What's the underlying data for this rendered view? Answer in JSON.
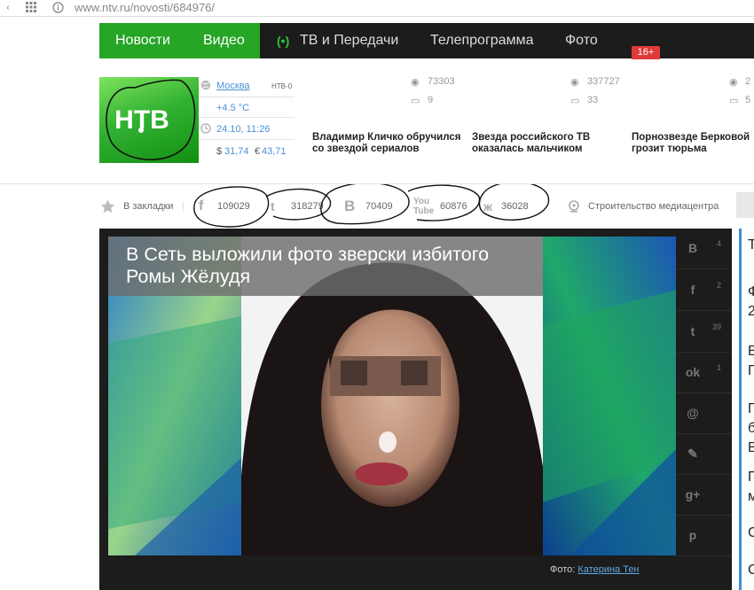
{
  "browser": {
    "url": "www.ntv.ru/novosti/684976/"
  },
  "nav": {
    "items": [
      "Новости",
      "Видео",
      "ТВ и Передачи",
      "Телепрограмма",
      "Фото"
    ],
    "live_marker": "(•)",
    "age_badge": "16+"
  },
  "logo": {
    "text": "НТВ"
  },
  "info": {
    "city": "Москва",
    "channel": "НТВ-0",
    "temp": "+4.5 °C",
    "datetime": "24.10, 11:26",
    "usd": "31,74",
    "eur": "43,71",
    "usd_symbol": "$",
    "eur_symbol": "€"
  },
  "top_news": [
    {
      "views": "73303",
      "comments": "9",
      "title": "Владимир Кличко обручился со звездой сериалов"
    },
    {
      "views": "337727",
      "comments": "33",
      "title": "Звезда российского ТВ оказалась мальчиком"
    },
    {
      "views": "",
      "comments": "",
      "title": "Порнозвезде Берковой грозит тюрьма"
    }
  ],
  "edge_stats": {
    "views": "2",
    "comments": "5"
  },
  "share": {
    "bookmark": "В закладки",
    "facebook": "109029",
    "twitter": "318279",
    "vk": "70409",
    "youtube": "60876",
    "ok": "36028",
    "media": "Строительство медиацентра"
  },
  "article": {
    "headline": "В Сеть выложили фото зверски избитого Ромы Жёлудя",
    "photo_credit_label": "Фото:",
    "photo_credit_name": "Катерина Тен"
  },
  "side_share": [
    {
      "icon": "B",
      "count": "4"
    },
    {
      "icon": "f",
      "count": "2"
    },
    {
      "icon": "t",
      "count": "39"
    },
    {
      "icon": "ok",
      "count": "1"
    },
    {
      "icon": "@",
      "count": ""
    },
    {
      "icon": "✎",
      "count": ""
    },
    {
      "icon": "g+",
      "count": ""
    },
    {
      "icon": "p",
      "count": ""
    }
  ],
  "right_column_letters": [
    "Т",
    "Ф",
    "2",
    "В",
    "П",
    "П",
    "б",
    "В",
    "П",
    "м",
    "С",
    "С"
  ]
}
